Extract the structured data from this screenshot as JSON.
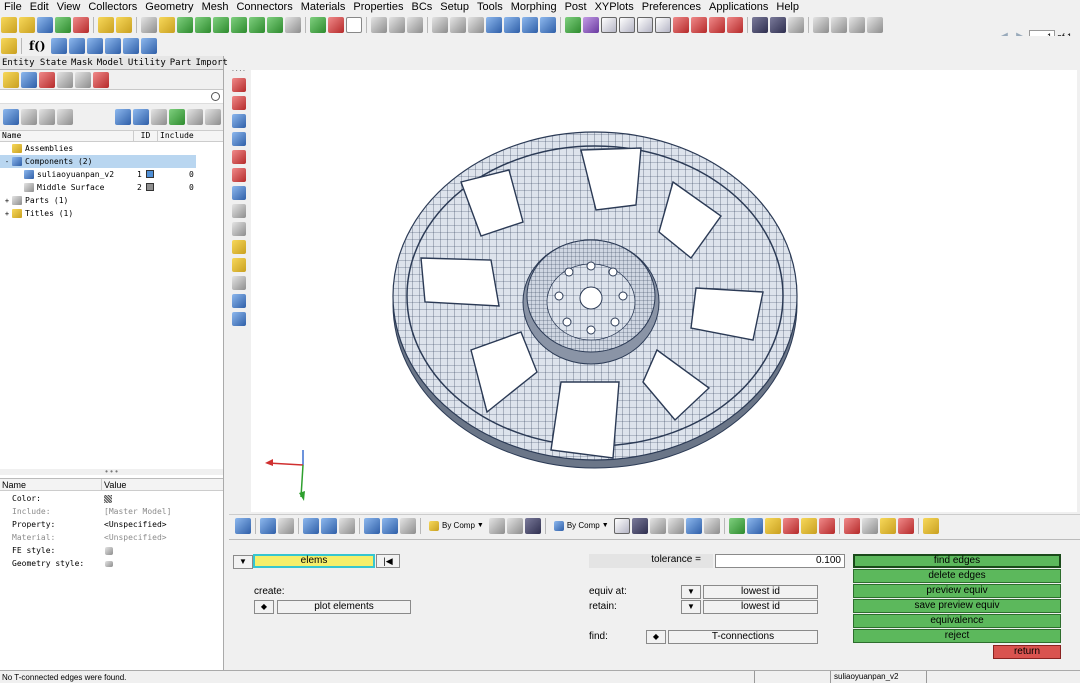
{
  "menu": [
    "File",
    "Edit",
    "View",
    "Collectors",
    "Geometry",
    "Mesh",
    "Connectors",
    "Materials",
    "Properties",
    "BCs",
    "Setup",
    "Tools",
    "Morphing",
    "Post",
    "XYPlots",
    "Preferences",
    "Applications",
    "Help"
  ],
  "toolbar": {
    "fx_label": "f()",
    "page_current": "1",
    "page_of": "of 1"
  },
  "left_panel": {
    "tabs": [
      "Entity State",
      "Mask",
      "Model",
      "Utility",
      "Part",
      "Import"
    ],
    "tree_headers": {
      "name": "Name",
      "id": "ID",
      "include": "Include"
    },
    "tree": [
      {
        "label": "Assemblies",
        "id": "",
        "include": "",
        "color": "",
        "expander": ""
      },
      {
        "label": "Components (2)",
        "id": "",
        "include": "",
        "color": "",
        "expander": "-"
      },
      {
        "label": "suliaoyuanpan_v2",
        "id": "1",
        "include": "0",
        "color": "#4f8fd6",
        "expander": ""
      },
      {
        "label": "Middle Surface",
        "id": "2",
        "include": "0",
        "color": "#8f8f8f",
        "expander": ""
      },
      {
        "label": "Parts (1)",
        "id": "",
        "include": "",
        "color": "",
        "expander": "+"
      },
      {
        "label": "Titles (1)",
        "id": "",
        "include": "",
        "color": "",
        "expander": "+"
      }
    ],
    "prop_headers": {
      "name": "Name",
      "value": "Value"
    },
    "properties": [
      {
        "name": "Color:",
        "value": "",
        "dim": false,
        "swatch": true
      },
      {
        "name": "Include:",
        "value": "[Master Model]",
        "dim": true,
        "swatch": false
      },
      {
        "name": "Property:",
        "value": "<Unspecified>",
        "dim": false,
        "swatch": false
      },
      {
        "name": "Material:",
        "value": "<Unspecified>",
        "dim": true,
        "swatch": false
      },
      {
        "name": "FE style:",
        "value": "",
        "dim": false,
        "swatch": false
      },
      {
        "name": "Geometry style:",
        "value": "",
        "dim": false,
        "swatch": false
      }
    ]
  },
  "view_toolbar": {
    "dropdown1": "By Comp",
    "dropdown2": "By Comp"
  },
  "panel": {
    "entity_selector": "elems",
    "create_label": "create:",
    "create_switch": "plot elements",
    "tolerance_label": "tolerance =",
    "tolerance_value": "0.100",
    "equiv_at_label": "equiv at:",
    "equiv_at_value": "lowest id",
    "retain_label": "retain:",
    "retain_value": "lowest id",
    "find_label": "find:",
    "find_value": "T-connections",
    "actions": [
      "find edges",
      "delete edges",
      "preview equiv",
      "save preview equiv",
      "equivalence",
      "reject"
    ],
    "return_label": "return"
  },
  "status": {
    "message": "No T-connected edges were found.",
    "component": "suliaoyuanpan_v2"
  },
  "colors": {
    "accent_green": "#5cb85c",
    "return_red": "#d9534f",
    "selector_yellow": "#f5ef6a",
    "mesh_fill": "#dde3ec",
    "mesh_line": "#2b3a55"
  }
}
